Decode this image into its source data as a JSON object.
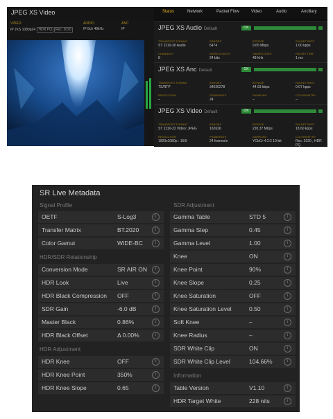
{
  "top": {
    "window_title": "JPEG XS Video",
    "streams": [
      {
        "head": "VIDEO",
        "value": "IP JXS 1080p24",
        "chips": [
          "HDR PQ",
          "Rec. 2020"
        ]
      },
      {
        "head": "AUDIO",
        "value": "IP 8ch 48kHz",
        "chips": []
      },
      {
        "head": "ANC",
        "value": "IP",
        "chips": []
      }
    ],
    "tabs": [
      "Status",
      "Network",
      "Packet Flow",
      "Video",
      "Audio",
      "Ancillary"
    ],
    "active_tab": "Status",
    "ok_label": "OK",
    "default_label": "Default",
    "sections": [
      {
        "title": "JPEG XS Audio",
        "fields": [
          {
            "label": "TRANSPORT FORMAT",
            "value": "ST 2110-30 Audio"
          },
          {
            "label": "ERRORS",
            "value": "6474"
          },
          {
            "label": "BITRATE",
            "value": "9.65 Mbps"
          },
          {
            "label": "PACKET RATE",
            "value": "1.00 kpps"
          },
          {
            "label": "CHANNELS",
            "value": "8"
          },
          {
            "label": "WORD LENGTH",
            "value": "24 bits"
          },
          {
            "label": "SAMPLE RATE",
            "value": "48 kHz"
          },
          {
            "label": "PACKET TIME",
            "value": "1 ms"
          }
        ]
      },
      {
        "title": "JPEG XS Anc",
        "fields": [
          {
            "label": "TRANSPORT FORMAT",
            "value": "TS/RTP"
          },
          {
            "label": "ERRORS",
            "value": "34020278"
          },
          {
            "label": "BITRATE",
            "value": "44.93 kbps"
          },
          {
            "label": "PACKET RATE",
            "value": "0.07 kpps"
          },
          {
            "label": "RESOLUTION",
            "value": "–"
          },
          {
            "label": "FRAMERATE",
            "value": "24"
          },
          {
            "label": "SAMPLING",
            "value": "–"
          },
          {
            "label": "COLORIMETRY",
            "value": "–"
          }
        ]
      },
      {
        "title": "JPEG XS Video",
        "fields": [
          {
            "label": "TRANSPORT FORMAT",
            "value": "ST 2110-22 Video: JPEG"
          },
          {
            "label": "ERRORS",
            "value": "162626"
          },
          {
            "label": "BITRATE",
            "value": "220.37 Mbps"
          },
          {
            "label": "PACKET RATE",
            "value": "18.60 kpps"
          },
          {
            "label": "RESOLUTION",
            "value": "1920x1080p : 16/9"
          },
          {
            "label": "FRAMERATE",
            "value": "24 frames/s"
          },
          {
            "label": "SAMPLING",
            "value": "YCbCr-4:2:2 10-bit"
          },
          {
            "label": "COLORIMETRY",
            "value": "Rec. 2020 , HDR PQ"
          }
        ]
      }
    ]
  },
  "meta": {
    "title": "SR Live Metadata",
    "left_sections": [
      {
        "heading": "Signal Profile",
        "rows": [
          {
            "label": "OETF",
            "value": "S-Log3"
          },
          {
            "label": "Transfer Matrix",
            "value": "BT.2020"
          },
          {
            "label": "Color Gamut",
            "value": "WIDE-BC"
          }
        ]
      },
      {
        "heading": "HDR/SDR Relationship",
        "rows": [
          {
            "label": "Conversion Mode",
            "value": "SR AIR ON"
          },
          {
            "label": "HDR Look",
            "value": "Live"
          },
          {
            "label": "HDR Black Compression",
            "value": "OFF"
          },
          {
            "label": "SDR Gain",
            "value": "-6.0 dB"
          },
          {
            "label": "Master Black",
            "value": "0.86%"
          },
          {
            "label": "HDR Black Offset",
            "value": "Δ 0.00%"
          }
        ]
      },
      {
        "heading": "HDR Adjustment",
        "rows": [
          {
            "label": "HDR Knee",
            "value": "OFF"
          },
          {
            "label": "HDR Knee Point",
            "value": "350%"
          },
          {
            "label": "HDR Knee Slope",
            "value": "0.65"
          }
        ]
      }
    ],
    "right_sections": [
      {
        "heading": "SDR Adjustment",
        "rows": [
          {
            "label": "Gamma Table",
            "value": "STD 5"
          },
          {
            "label": "Gamma Step",
            "value": "0.45"
          },
          {
            "label": "Gamma Level",
            "value": "1.00"
          },
          {
            "label": "Knee",
            "value": "ON"
          },
          {
            "label": "Knee Point",
            "value": "90%"
          },
          {
            "label": "Knee Slope",
            "value": "0.25"
          },
          {
            "label": "Knee Saturation",
            "value": "OFF"
          },
          {
            "label": "Knee Saturation Level",
            "value": "0.50"
          },
          {
            "label": "Soft Knee",
            "value": "–"
          },
          {
            "label": "Knee Radius",
            "value": "–"
          },
          {
            "label": "SDR White Clip",
            "value": "ON"
          },
          {
            "label": "SDR White Clip Level",
            "value": "104.66%"
          }
        ]
      },
      {
        "heading": "Information",
        "rows": [
          {
            "label": "Table Version",
            "value": "V1.10"
          },
          {
            "label": "HDR Target White",
            "value": "228 nits"
          }
        ]
      }
    ]
  },
  "colors": {
    "accent": "#e6b422",
    "ok": "#2e8b3a",
    "panel": "#222222"
  },
  "icons": {
    "info": "info-icon"
  }
}
